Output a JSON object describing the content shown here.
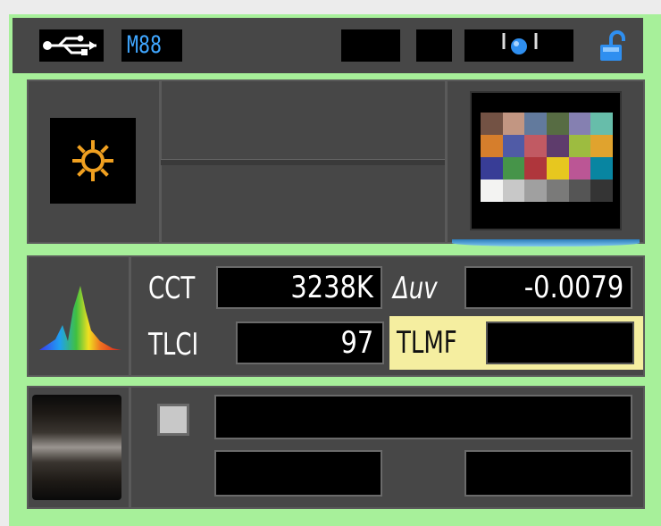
{
  "status_bar": {
    "usb_icon": "usb-icon",
    "mode_label": "M88",
    "lock_icon": "unlocked-padlock-icon",
    "indicator_icon": "blue-dot-icon"
  },
  "top_panel": {
    "light_source_icon": "sun-icon",
    "color_chart_icon": "color-checker-icon"
  },
  "measure_panel": {
    "spectrum_icon": "spectrum-icon",
    "cct_label": "CCT",
    "cct_value": "3238K",
    "duv_label": "Δuv",
    "duv_value": "-0.0079",
    "tlci_label": "TLCI",
    "tlci_value": "97",
    "tlmf_label": "TLMF",
    "tlmf_value": ""
  },
  "bottom_panel": {
    "dial_icon": "dial-wheel-icon",
    "checkbox_checked": false
  },
  "colors": {
    "background_green": "#a7f09a",
    "panel_gray": "#474747",
    "mode_blue": "#3fa6ff",
    "tlmf_highlight": "#f5eea0",
    "sun_orange": "#f0a020"
  },
  "color_checker": [
    [
      "#735244",
      "#c29682",
      "#627a9d",
      "#576c43",
      "#8580b1",
      "#67bdaa"
    ],
    [
      "#d67e2c",
      "#505ba6",
      "#c15a63",
      "#5e3c6c",
      "#9dbc40",
      "#e0a32e"
    ],
    [
      "#383d96",
      "#469449",
      "#af363c",
      "#e7c71f",
      "#bb5695",
      "#0885a1"
    ],
    [
      "#f3f3f2",
      "#c8c8c8",
      "#a0a0a0",
      "#7a7a79",
      "#555555",
      "#343434"
    ]
  ]
}
